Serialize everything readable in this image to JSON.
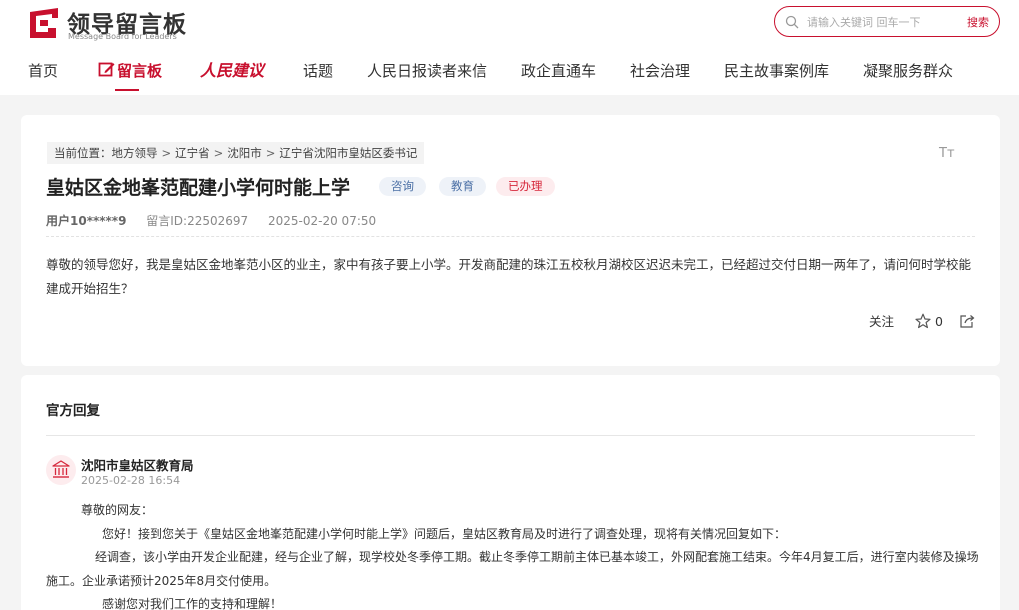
{
  "header": {
    "logo_title": "领导留言板",
    "logo_subtitle": "Message Board for Leaders",
    "search": {
      "placeholder": "请输入关键词 回车一下",
      "button_label": "搜索"
    }
  },
  "nav": {
    "items": [
      {
        "label": "首页"
      },
      {
        "label": "留言板",
        "active": true,
        "icon": "edit-icon"
      },
      {
        "label": "人民建议"
      },
      {
        "label": "话题"
      },
      {
        "label": "人民日报读者来信"
      },
      {
        "label": "政企直通车"
      },
      {
        "label": "社会治理"
      },
      {
        "label": "民主故事案例库"
      },
      {
        "label": "凝聚服务群众"
      }
    ]
  },
  "message": {
    "breadcrumb": {
      "prefix": "当前位置：",
      "items": [
        "地方领导",
        "辽宁省",
        "沈阳市",
        "辽宁省沈阳市皇姑区委书记"
      ],
      "separator": ">"
    },
    "font_toggle": "Tт",
    "title": "皇姑区金地峯范配建小学何时能上学",
    "tags": [
      "咨询",
      "教育",
      "已办理"
    ],
    "user": "用户10*****9",
    "message_id": "留言ID:22502697",
    "datetime": "2025-02-20 07:50",
    "content": "尊敬的领导您好，我是皇姑区金地峯范小区的业主，家中有孩子要上小学。开发商配建的珠江五校秋月湖校区迟迟未完工，已经超过交付日期一两年了，请问何时学校能建成开始招生？",
    "actions": {
      "follow_label": "关注",
      "like_count": "0"
    }
  },
  "reply": {
    "heading": "官方回复",
    "org_name": "沈阳市皇姑区教育局",
    "time": "2025-02-28 16:54",
    "greeting": "尊敬的网友：",
    "p1": "您好！接到您关于《皇姑区金地峯范配建小学何时能上学》问题后，皇姑区教育局及时进行了调查处理，现将有关情况回复如下：",
    "p2": "经调查，该小学由开发企业配建，经与企业了解，现学校处冬季停工期。截止冬季停工期前主体已基本竣工，外网配套施工结束。今年4月复工后，进行室内装修及操场施工。企业承诺预计2025年8月交付使用。",
    "p3": "感谢您对我们工作的支持和理解！"
  },
  "colors": {
    "brand": "#c8102e",
    "tag_blue_bg": "#eef2f8",
    "tag_red_bg": "#fdecee"
  }
}
